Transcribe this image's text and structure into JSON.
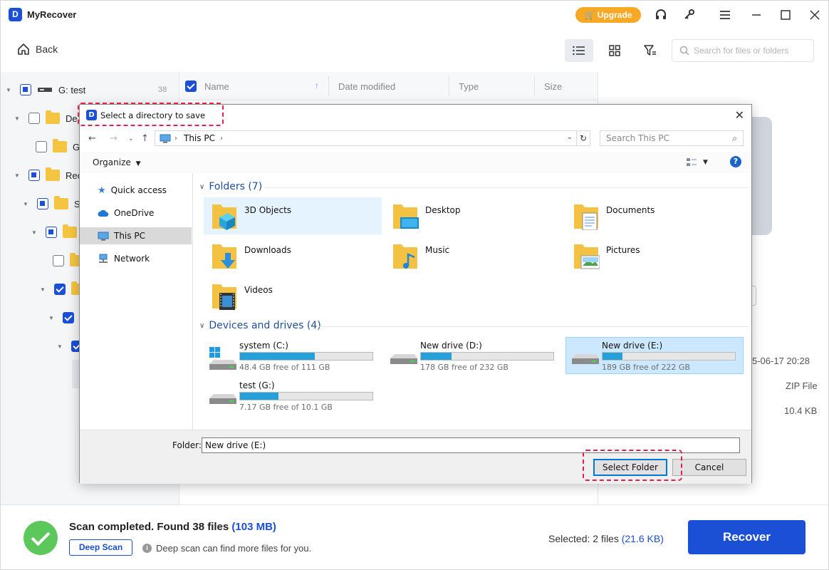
{
  "app": {
    "title": "MyRecover",
    "upgrade_label": "Upgrade"
  },
  "toolbar": {
    "back_label": "Back",
    "search_placeholder": "Search for files or folders"
  },
  "tree": {
    "root_label": "G: test",
    "root_count": "38",
    "items": [
      {
        "label": "De"
      },
      {
        "label": "G"
      },
      {
        "label": "Rec"
      },
      {
        "label": "S-"
      }
    ]
  },
  "file_header": {
    "name": "Name",
    "date": "Date modified",
    "type": "Type",
    "size": "Size"
  },
  "details": {
    "date": "5-06-17 20:28",
    "type": "ZIP File",
    "size": "10.4 KB"
  },
  "bottom": {
    "scan_text": "Scan completed. Found 38 files",
    "scan_size": "(103 MB)",
    "deep_scan_label": "Deep Scan",
    "deep_scan_info": "Deep scan can find more files for you.",
    "selected_prefix": "Selected: 2 files",
    "selected_size": "(21.6 KB)",
    "recover_label": "Recover"
  },
  "dialog": {
    "title": "Select a directory to save",
    "address": "This PC",
    "search_placeholder": "Search This PC",
    "organize_label": "Organize",
    "nav": [
      {
        "label": "Quick access"
      },
      {
        "label": "OneDrive"
      },
      {
        "label": "This PC"
      },
      {
        "label": "Network"
      }
    ],
    "folders_header": "Folders (7)",
    "folders": [
      {
        "name": "3D Objects"
      },
      {
        "name": "Desktop"
      },
      {
        "name": "Documents"
      },
      {
        "name": "Downloads"
      },
      {
        "name": "Music"
      },
      {
        "name": "Pictures"
      },
      {
        "name": "Videos"
      }
    ],
    "drives_header": "Devices and drives (4)",
    "drives": [
      {
        "name": "system (C:)",
        "free": "48.4 GB free of 111 GB",
        "used_fraction": 0.564
      },
      {
        "name": "New drive (D:)",
        "free": "178 GB free of 232 GB",
        "used_fraction": 0.233
      },
      {
        "name": "New drive (E:)",
        "free": "189 GB free of 222 GB",
        "used_fraction": 0.149
      },
      {
        "name": "test (G:)",
        "free": "7.17 GB free of 10.1 GB",
        "used_fraction": 0.29
      }
    ],
    "folder_label": "Folder:",
    "folder_value": "New drive (E:)",
    "select_label": "Select Folder",
    "cancel_label": "Cancel"
  },
  "colors": {
    "accent": "#1a4fd6",
    "upgrade": "#f7a824",
    "success": "#5cc85c",
    "highlight": "#e0234e"
  }
}
